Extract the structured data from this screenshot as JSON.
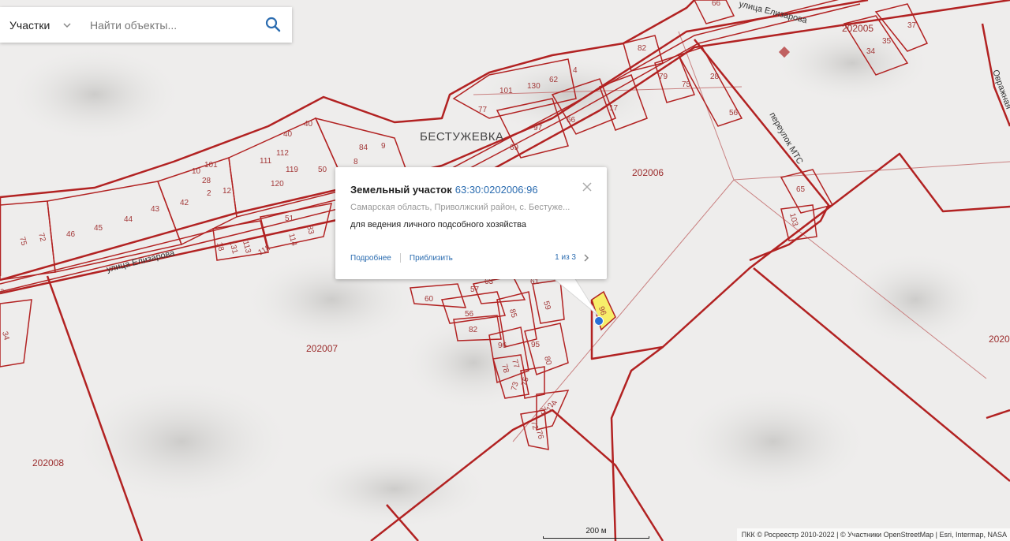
{
  "search": {
    "layer_label": "Участки",
    "placeholder": "Найти объекты...",
    "value": ""
  },
  "popup": {
    "title": "Земельный участок",
    "cadastral_number": "63:30:0202006:96",
    "address": "Самарская область, Приволжский район, с. Бестуже...",
    "purpose": "для ведения личного подсобного хозяйства",
    "link_details": "Подробнее",
    "link_zoom": "Приблизить",
    "pager": "1 из 3"
  },
  "map": {
    "town_label": "БЕСТУЖЕВКА",
    "streets": [
      "улица Елизарова",
      "улица Елизарова",
      "переулок МТС",
      "Овражная"
    ],
    "districts": [
      "202006",
      "202007",
      "202008",
      "202005",
      "2020"
    ],
    "parcel_labels": [
      "66",
      "37",
      "35",
      "34",
      "40",
      "40",
      "101",
      "77",
      "130",
      "62",
      "4",
      "82",
      "79",
      "75",
      "28",
      "56",
      "17",
      "66",
      "97",
      "69",
      "84",
      "9",
      "112",
      "111",
      "120",
      "119",
      "50",
      "101",
      "10",
      "28",
      "2",
      "12",
      "42",
      "43",
      "44",
      "45",
      "46",
      "72",
      "75",
      "8",
      "51",
      "114",
      "83",
      "118",
      "113",
      "131",
      "18",
      "65",
      "103",
      "63",
      "57",
      "61",
      "59",
      "60",
      "56",
      "82",
      "85",
      "96",
      "95",
      "77",
      "78",
      "80",
      "73",
      "75",
      "71",
      "72",
      "76",
      "72",
      "4",
      "34",
      "a"
    ],
    "selected_parcel_label": "96",
    "colors": {
      "boundary": "#b22222",
      "selected_fill": "#f7ee6a",
      "marker": "#2a6fd6"
    }
  },
  "scale": {
    "label": "200 м"
  },
  "attribution": "ПКК © Росреестр 2010-2022 | © Участники OpenStreetMap | Esri, Intermap, NASA"
}
